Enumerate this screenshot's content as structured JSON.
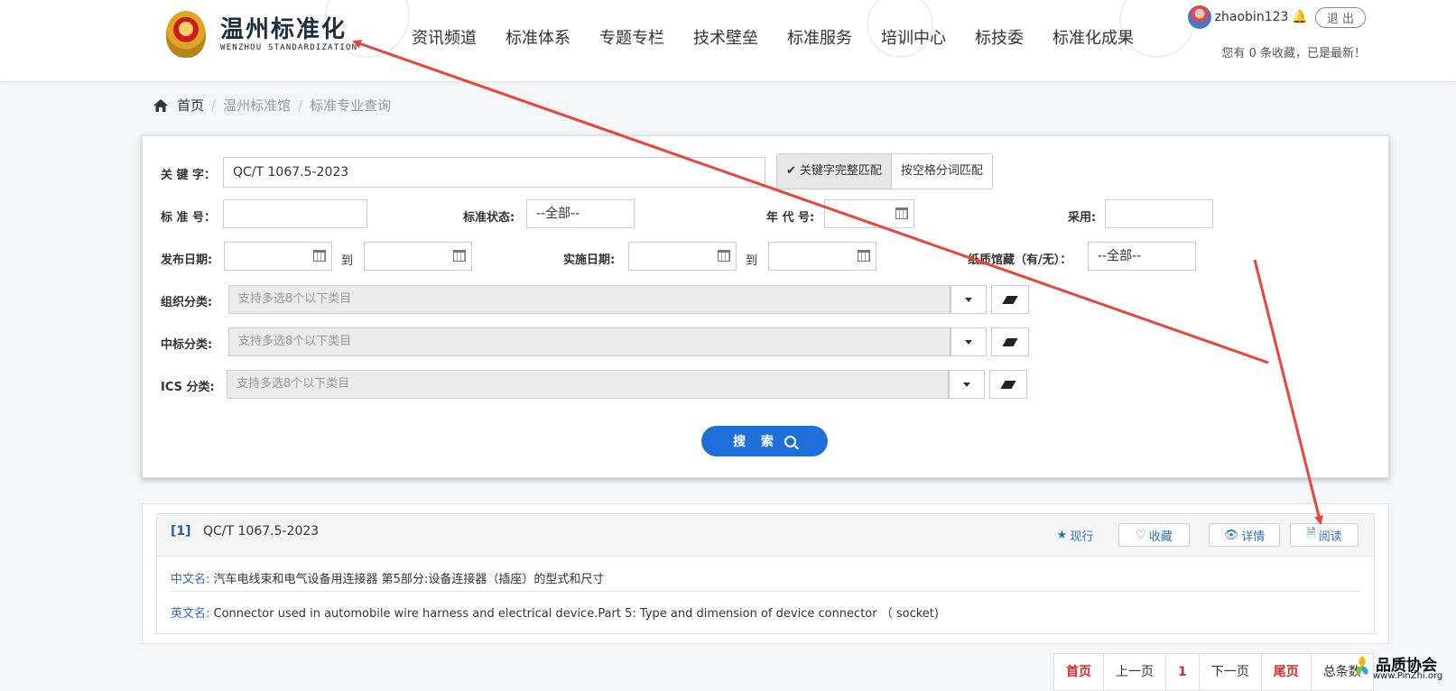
{
  "header": {
    "logo_cn": "温州标准化",
    "logo_en": "WENZHOU STANDARDIZATION",
    "nav": [
      "资讯频道",
      "标准体系",
      "专题专栏",
      "技术壁垒",
      "标准服务",
      "培训中心",
      "标技委",
      "标准化成果"
    ],
    "username": "zhaobin123",
    "logout": "退 出",
    "favorite_note": "您有 0 条收藏，已是最新！"
  },
  "breadcrumb": {
    "home": "首页",
    "items": [
      "温州标准馆",
      "标准专业查询"
    ],
    "sep": "/"
  },
  "search": {
    "keyword_label": "关 键 字：",
    "keyword_value": "QC/T 1067.5-2023",
    "match_full": "关键字完整匹配",
    "match_split": "按空格分词匹配",
    "std_no_label": "标 准 号：",
    "status_label": "标准状态:",
    "status_value": "--全部--",
    "year_label": "年 代 号:",
    "adopt_label": "采用:",
    "pub_date_label": "发布日期:",
    "to": "到",
    "impl_date_label": "实施日期:",
    "paper_label": "纸质馆藏（有/无）：",
    "paper_value": "--全部--",
    "org_label": "组织分类:",
    "ccs_label": "中标分类:",
    "ics_label": "ICS 分类:",
    "multi_placeholder": "支持多选8个以下类目",
    "search_btn": "搜 索"
  },
  "result": {
    "index": "[1]",
    "code": "QC/T 1067.5-2023",
    "status": "现行",
    "favorite": "收藏",
    "detail": "详情",
    "read": "阅读",
    "cn_label": "中文名:",
    "cn_name": "汽车电线束和电气设备用连接器 第5部分:设备连接器（插座）的型式和尺寸",
    "en_label": "英文名:",
    "en_name": "Connector used in automobile wire harness and electrical device.Part 5: Type and dimension of device connector （ socket)"
  },
  "pager": {
    "first": "首页",
    "prev": "上一页",
    "current": "1",
    "next": "下一页",
    "last": "尾页",
    "total": "总条数"
  },
  "watermark": {
    "text": "品质协会",
    "url": "www.PinZhi.org"
  },
  "colors": {
    "primary": "#1f6fd9",
    "link": "#2c6fbf",
    "arrow": "#e8453c",
    "pager_red": "#e02a2a"
  }
}
